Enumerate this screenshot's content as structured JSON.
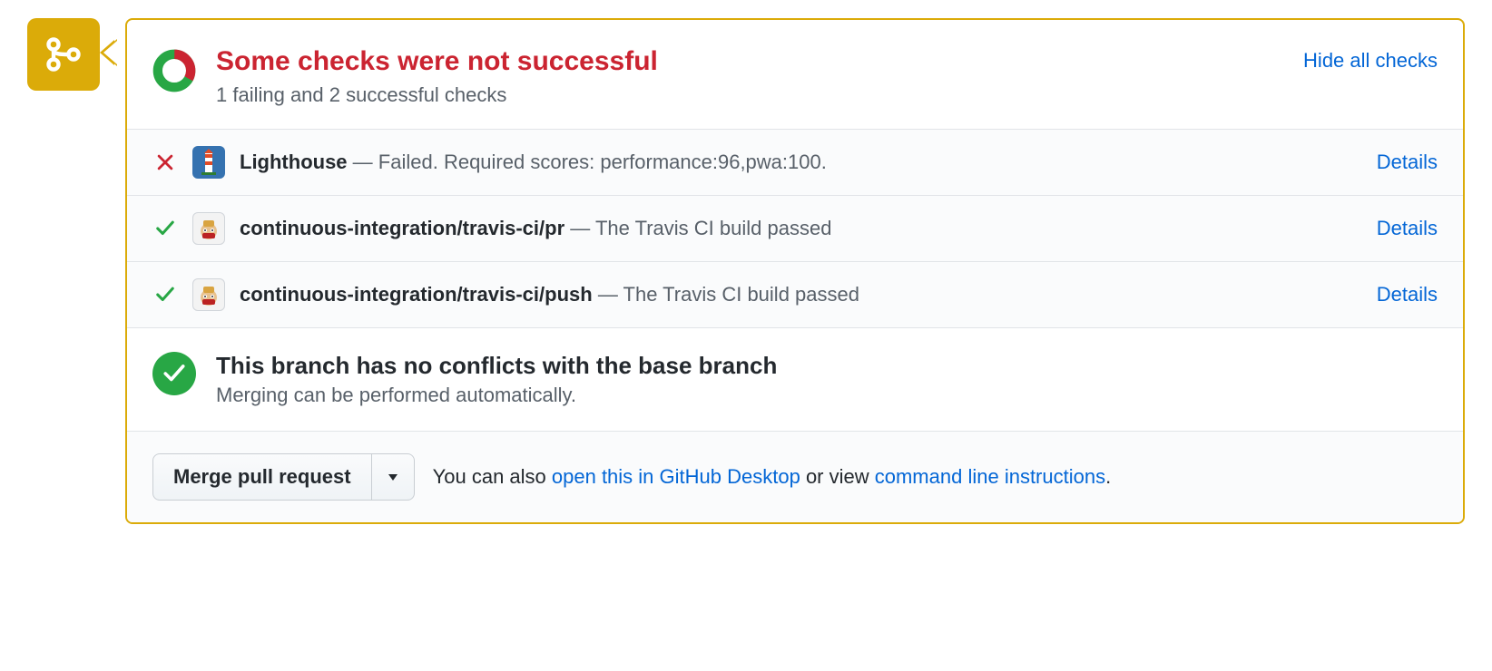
{
  "header": {
    "title": "Some checks were not successful",
    "subtitle": "1 failing and 2 successful checks",
    "toggle_label": "Hide all checks"
  },
  "checks": [
    {
      "status": "fail",
      "avatar": "lighthouse",
      "name": "Lighthouse",
      "message": "Failed. Required scores: performance:96,pwa:100.",
      "details_label": "Details"
    },
    {
      "status": "pass",
      "avatar": "travis",
      "name": "continuous-integration/travis-ci/pr",
      "message": "The Travis CI build passed",
      "details_label": "Details"
    },
    {
      "status": "pass",
      "avatar": "travis",
      "name": "continuous-integration/travis-ci/push",
      "message": "The Travis CI build passed",
      "details_label": "Details"
    }
  ],
  "conflict": {
    "title": "This branch has no conflicts with the base branch",
    "subtitle": "Merging can be performed automatically."
  },
  "footer": {
    "merge_button": "Merge pull request",
    "prefix": "You can also ",
    "link1": "open this in GitHub Desktop",
    "middle": " or view ",
    "link2": "command line instructions",
    "suffix": "."
  }
}
